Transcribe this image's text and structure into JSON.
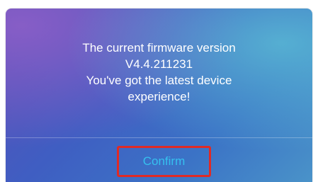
{
  "dialog": {
    "message_lines": [
      "The current firmware version",
      "V4.4.211231",
      "You've got the latest device",
      "experience!"
    ],
    "confirm_label": "Confirm"
  },
  "colors": {
    "confirm_text": "#35c0ef",
    "highlight_border": "#e02a25",
    "message_text": "#ffffff"
  }
}
